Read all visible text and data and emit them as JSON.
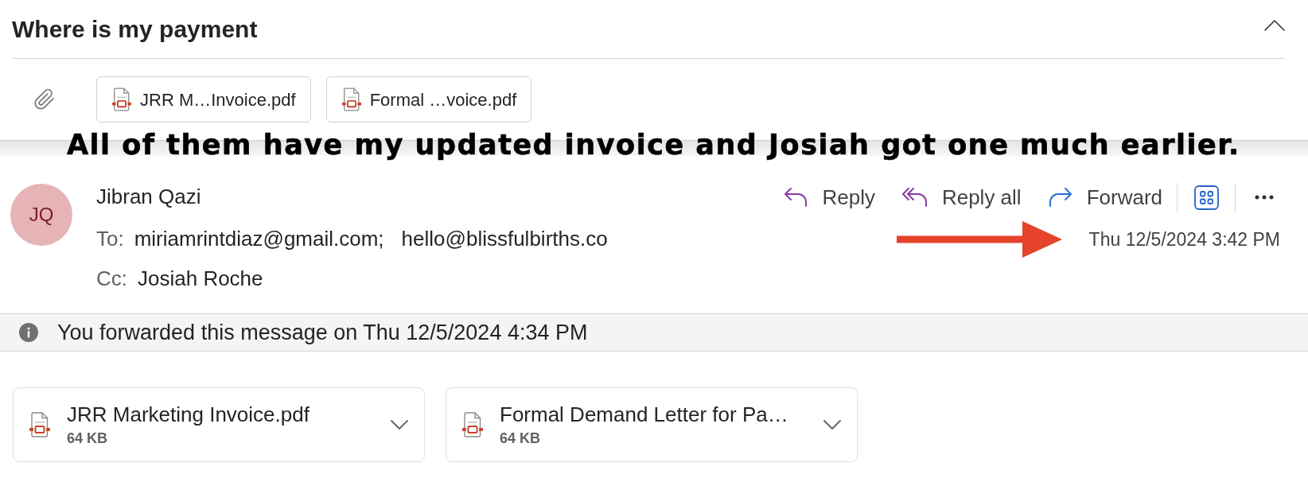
{
  "subject": {
    "title": "Where is my payment"
  },
  "attachment_bar": {
    "attachments": [
      {
        "name": "JRR M…Invoice.pdf"
      },
      {
        "name": "Formal …voice.pdf"
      }
    ]
  },
  "annotation": {
    "text": "All of them have my updated invoice and Josiah got one much earlier."
  },
  "message": {
    "avatar_initials": "JQ",
    "sender": "Jibran Qazi",
    "to_label": "To:",
    "to": [
      "miriamrintdiaz@gmail.com;",
      "hello@blissfulbirths.co"
    ],
    "cc_label": "Cc:",
    "cc": [
      "Josiah Roche"
    ],
    "actions": [
      {
        "kind": "reply",
        "label": "Reply"
      },
      {
        "kind": "reply_all",
        "label": "Reply all"
      },
      {
        "kind": "forward",
        "label": "Forward"
      }
    ],
    "date": "Thu 12/5/2024 3:42 PM"
  },
  "info_bar": {
    "text": "You forwarded this message on Thu 12/5/2024 4:34 PM"
  },
  "attachments": [
    {
      "name": "JRR Marketing Invoice.pdf",
      "size": "64 KB"
    },
    {
      "name": "Formal Demand Letter for Pa…",
      "size": "64 KB"
    }
  ]
}
